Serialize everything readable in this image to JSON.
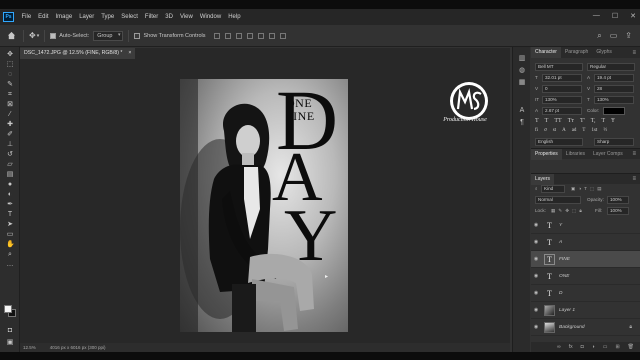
{
  "menu": {
    "app_icon": "Ps",
    "items": [
      "File",
      "Edit",
      "Image",
      "Layer",
      "Type",
      "Select",
      "Filter",
      "3D",
      "View",
      "Window",
      "Help"
    ],
    "window_controls": [
      "—",
      "☐",
      "✕"
    ]
  },
  "options_bar": {
    "auto_select_label": "Auto-Select:",
    "auto_select_checked": true,
    "auto_select_value": "Group",
    "transform_controls_label": "Show Transform Controls",
    "transform_controls_checked": false
  },
  "document_tab": {
    "title": "DSC_1472.JPG @ 12.5% (FINE, RGB/8) *",
    "close": "×"
  },
  "canvas": {
    "poster_text": {
      "one": "ONE",
      "fine": "FINE",
      "d": "D",
      "a": "A",
      "y": "Y"
    },
    "logo_sub": "Production House"
  },
  "status_bar": {
    "zoom": "12.5%",
    "doc_info": "4016 px x 6016 px (300 ppi)"
  },
  "character_panel": {
    "tabs": [
      "Character",
      "Paragraph",
      "Glyphs"
    ],
    "font_family": "Bell MT",
    "font_style": "Regular",
    "font_size": "32.01 pt",
    "leading": "19.4 pt",
    "tracking": "0",
    "kerning": "28",
    "vertical_scale": "130%",
    "horizontal_scale": "130%",
    "baseline_shift": "2.67 pt",
    "color_label": "Color:",
    "color_value": "#000000",
    "type_buttons": [
      "T",
      "T",
      "TT",
      "Tт",
      "T'",
      "T,",
      "T",
      "Ŧ"
    ],
    "opentype_buttons": [
      "fi",
      "ơ",
      "st",
      "A",
      "ad",
      "T",
      "1st",
      "½"
    ],
    "language": "English",
    "antialias": "Sharp"
  },
  "properties_panel": {
    "tabs": [
      "Properties",
      "Libraries",
      "Layer Comps"
    ]
  },
  "layers_panel": {
    "title": "Layers",
    "filter_kind": "Kind",
    "blend_mode": "Normal",
    "opacity_label": "Opacity:",
    "opacity_value": "100%",
    "lock_label": "Lock:",
    "fill_label": "Fill:",
    "fill_value": "100%",
    "layers": [
      {
        "name": "Y",
        "type": "text",
        "selected": false
      },
      {
        "name": "A",
        "type": "text",
        "selected": false
      },
      {
        "name": "FINE",
        "type": "text",
        "selected": true
      },
      {
        "name": "ONE",
        "type": "text",
        "selected": false
      },
      {
        "name": "D",
        "type": "text",
        "selected": false
      },
      {
        "name": "Layer 1",
        "type": "image",
        "selected": false
      },
      {
        "name": "Background",
        "type": "background",
        "selected": false
      }
    ]
  }
}
